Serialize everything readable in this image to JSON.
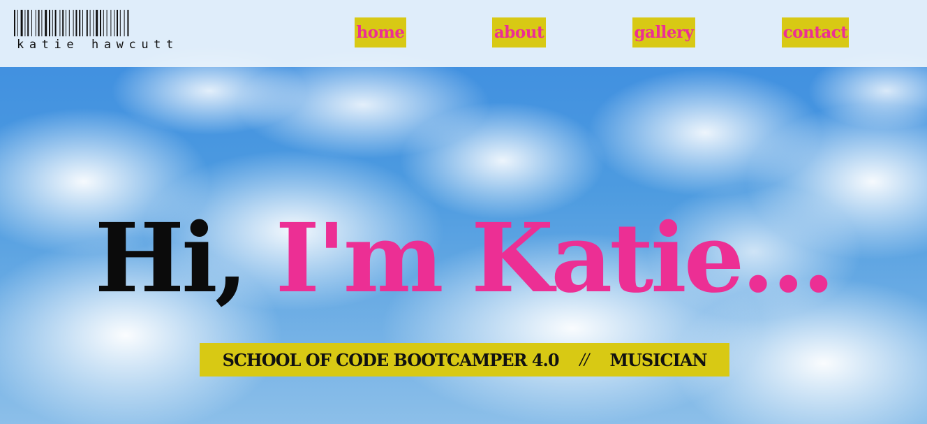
{
  "colors": {
    "accent_yellow": "#d8c914",
    "brand_pink": "#ec2f94",
    "text_dark": "#0b0b0b",
    "header_bg": "#ecf4fc",
    "sky_blue": "#3b8be0"
  },
  "header": {
    "logo_icon": "barcode-icon",
    "logo_text": "katie hawcutt",
    "nav": {
      "home": "home",
      "about": "about",
      "gallery": "gallery",
      "contact": "contact"
    }
  },
  "hero": {
    "greeting": "Hi,",
    "name": "I'm Katie...",
    "tagline": {
      "role_1": "SCHOOL OF CODE BOOTCAMPER 4.0",
      "separator": "//",
      "role_2": "MUSICIAN"
    }
  },
  "background": {
    "image": "sky-with-clouds"
  }
}
